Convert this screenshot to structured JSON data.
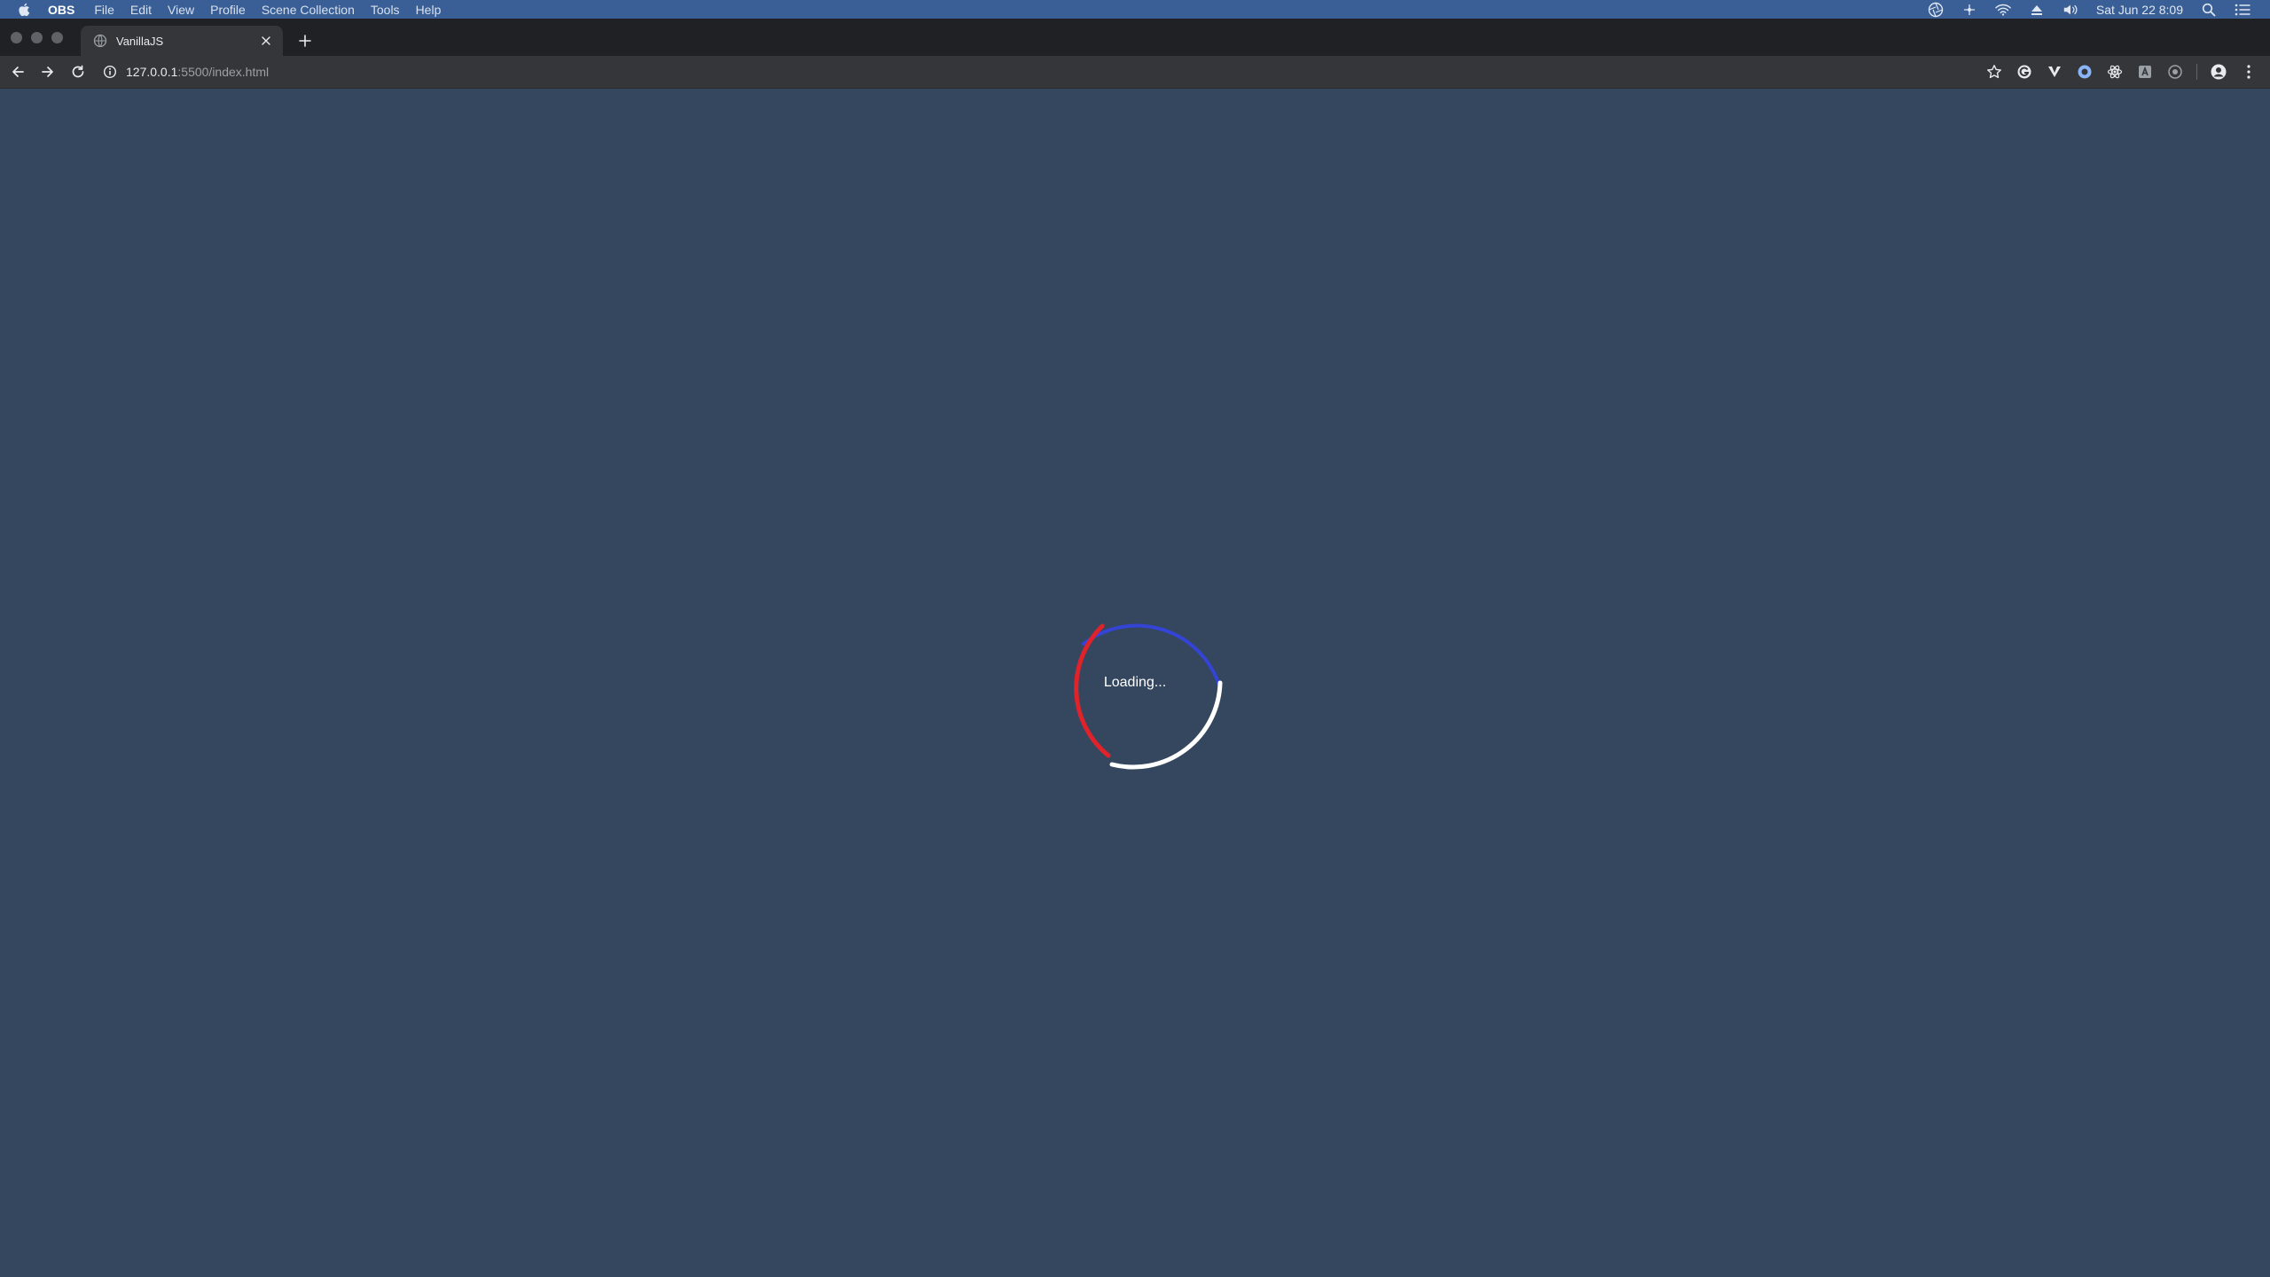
{
  "menubar": {
    "app_name": "OBS",
    "items": [
      "File",
      "Edit",
      "View",
      "Profile",
      "Scene Collection",
      "Tools",
      "Help"
    ],
    "clock": "Sat Jun 22  8:09"
  },
  "browser": {
    "tab": {
      "title": "VanillaJS"
    },
    "url_host": "127.0.0.1",
    "url_path": ":5500/index.html"
  },
  "page": {
    "loading_text": "Loading...",
    "spinner_colors": {
      "top": "#3344d6",
      "left": "#e0222b",
      "bottom": "#ffffff"
    },
    "background": "#34475e"
  }
}
